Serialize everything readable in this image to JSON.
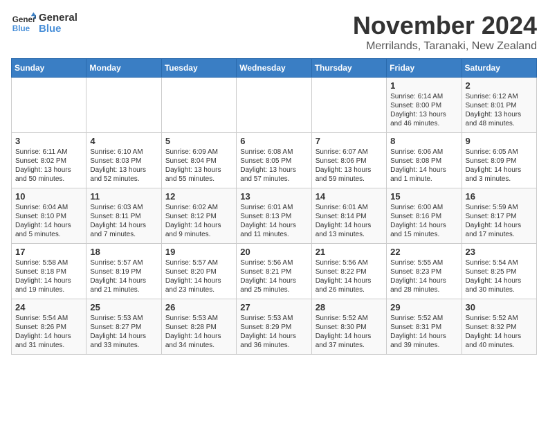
{
  "logo": {
    "line1": "General",
    "line2": "Blue"
  },
  "header": {
    "month": "November 2024",
    "location": "Merrilands, Taranaki, New Zealand"
  },
  "weekdays": [
    "Sunday",
    "Monday",
    "Tuesday",
    "Wednesday",
    "Thursday",
    "Friday",
    "Saturday"
  ],
  "weeks": [
    [
      {
        "day": "",
        "info": ""
      },
      {
        "day": "",
        "info": ""
      },
      {
        "day": "",
        "info": ""
      },
      {
        "day": "",
        "info": ""
      },
      {
        "day": "",
        "info": ""
      },
      {
        "day": "1",
        "info": "Sunrise: 6:14 AM\nSunset: 8:00 PM\nDaylight: 13 hours and 46 minutes."
      },
      {
        "day": "2",
        "info": "Sunrise: 6:12 AM\nSunset: 8:01 PM\nDaylight: 13 hours and 48 minutes."
      }
    ],
    [
      {
        "day": "3",
        "info": "Sunrise: 6:11 AM\nSunset: 8:02 PM\nDaylight: 13 hours and 50 minutes."
      },
      {
        "day": "4",
        "info": "Sunrise: 6:10 AM\nSunset: 8:03 PM\nDaylight: 13 hours and 52 minutes."
      },
      {
        "day": "5",
        "info": "Sunrise: 6:09 AM\nSunset: 8:04 PM\nDaylight: 13 hours and 55 minutes."
      },
      {
        "day": "6",
        "info": "Sunrise: 6:08 AM\nSunset: 8:05 PM\nDaylight: 13 hours and 57 minutes."
      },
      {
        "day": "7",
        "info": "Sunrise: 6:07 AM\nSunset: 8:06 PM\nDaylight: 13 hours and 59 minutes."
      },
      {
        "day": "8",
        "info": "Sunrise: 6:06 AM\nSunset: 8:08 PM\nDaylight: 14 hours and 1 minute."
      },
      {
        "day": "9",
        "info": "Sunrise: 6:05 AM\nSunset: 8:09 PM\nDaylight: 14 hours and 3 minutes."
      }
    ],
    [
      {
        "day": "10",
        "info": "Sunrise: 6:04 AM\nSunset: 8:10 PM\nDaylight: 14 hours and 5 minutes."
      },
      {
        "day": "11",
        "info": "Sunrise: 6:03 AM\nSunset: 8:11 PM\nDaylight: 14 hours and 7 minutes."
      },
      {
        "day": "12",
        "info": "Sunrise: 6:02 AM\nSunset: 8:12 PM\nDaylight: 14 hours and 9 minutes."
      },
      {
        "day": "13",
        "info": "Sunrise: 6:01 AM\nSunset: 8:13 PM\nDaylight: 14 hours and 11 minutes."
      },
      {
        "day": "14",
        "info": "Sunrise: 6:01 AM\nSunset: 8:14 PM\nDaylight: 14 hours and 13 minutes."
      },
      {
        "day": "15",
        "info": "Sunrise: 6:00 AM\nSunset: 8:16 PM\nDaylight: 14 hours and 15 minutes."
      },
      {
        "day": "16",
        "info": "Sunrise: 5:59 AM\nSunset: 8:17 PM\nDaylight: 14 hours and 17 minutes."
      }
    ],
    [
      {
        "day": "17",
        "info": "Sunrise: 5:58 AM\nSunset: 8:18 PM\nDaylight: 14 hours and 19 minutes."
      },
      {
        "day": "18",
        "info": "Sunrise: 5:57 AM\nSunset: 8:19 PM\nDaylight: 14 hours and 21 minutes."
      },
      {
        "day": "19",
        "info": "Sunrise: 5:57 AM\nSunset: 8:20 PM\nDaylight: 14 hours and 23 minutes."
      },
      {
        "day": "20",
        "info": "Sunrise: 5:56 AM\nSunset: 8:21 PM\nDaylight: 14 hours and 25 minutes."
      },
      {
        "day": "21",
        "info": "Sunrise: 5:56 AM\nSunset: 8:22 PM\nDaylight: 14 hours and 26 minutes."
      },
      {
        "day": "22",
        "info": "Sunrise: 5:55 AM\nSunset: 8:23 PM\nDaylight: 14 hours and 28 minutes."
      },
      {
        "day": "23",
        "info": "Sunrise: 5:54 AM\nSunset: 8:25 PM\nDaylight: 14 hours and 30 minutes."
      }
    ],
    [
      {
        "day": "24",
        "info": "Sunrise: 5:54 AM\nSunset: 8:26 PM\nDaylight: 14 hours and 31 minutes."
      },
      {
        "day": "25",
        "info": "Sunrise: 5:53 AM\nSunset: 8:27 PM\nDaylight: 14 hours and 33 minutes."
      },
      {
        "day": "26",
        "info": "Sunrise: 5:53 AM\nSunset: 8:28 PM\nDaylight: 14 hours and 34 minutes."
      },
      {
        "day": "27",
        "info": "Sunrise: 5:53 AM\nSunset: 8:29 PM\nDaylight: 14 hours and 36 minutes."
      },
      {
        "day": "28",
        "info": "Sunrise: 5:52 AM\nSunset: 8:30 PM\nDaylight: 14 hours and 37 minutes."
      },
      {
        "day": "29",
        "info": "Sunrise: 5:52 AM\nSunset: 8:31 PM\nDaylight: 14 hours and 39 minutes."
      },
      {
        "day": "30",
        "info": "Sunrise: 5:52 AM\nSunset: 8:32 PM\nDaylight: 14 hours and 40 minutes."
      }
    ]
  ]
}
